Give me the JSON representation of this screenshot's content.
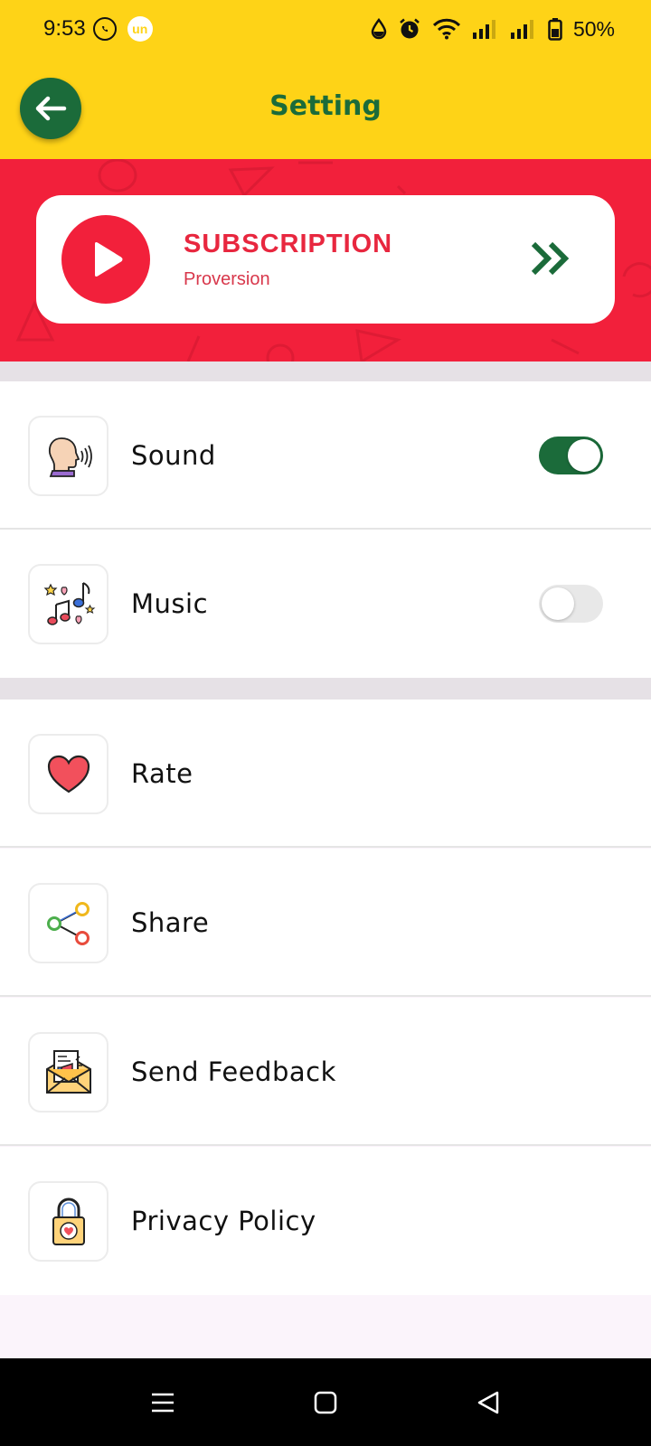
{
  "status_bar": {
    "time": "9:53",
    "battery": "50%",
    "notification_icons": [
      "whatsapp-icon",
      "un-icon"
    ],
    "system_icons": [
      "data-saver-icon",
      "alarm-icon",
      "wifi-icon",
      "signal-icon",
      "signal-icon",
      "battery-icon"
    ],
    "un_badge": "un"
  },
  "app_bar": {
    "title": "Setting",
    "back_icon": "arrow-left-icon"
  },
  "subscription": {
    "title": "SUBSCRIPTION",
    "subtitle": "Proversion",
    "icon": "play-icon",
    "arrow_icon": "double-chevron-right-icon"
  },
  "settings_group": [
    {
      "label": "Sound",
      "icon": "speaking-head-icon",
      "toggle": true
    },
    {
      "label": "Music",
      "icon": "music-notes-icon",
      "toggle": false
    }
  ],
  "actions_group": [
    {
      "label": "Rate",
      "icon": "heart-icon"
    },
    {
      "label": "Share",
      "icon": "share-icon"
    },
    {
      "label": "Send Feedback",
      "icon": "feedback-envelope-icon"
    },
    {
      "label": "Privacy Policy",
      "icon": "padlock-icon"
    }
  ],
  "colors": {
    "app_bar": "#fed317",
    "accent_green": "#1b6b3a",
    "banner_red": "#f2203b",
    "subscription_text": "#e8273f"
  },
  "nav_bar": {
    "buttons": [
      "menu-icon",
      "home-icon",
      "back-icon"
    ]
  }
}
